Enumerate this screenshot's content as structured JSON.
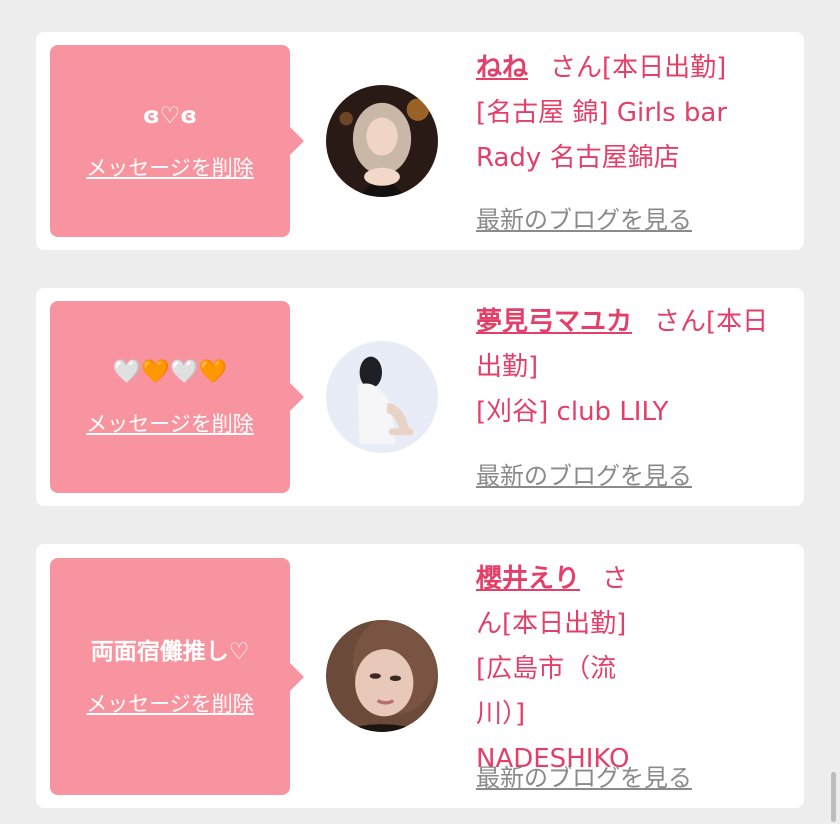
{
  "cards": [
    {
      "message": "ɞ♡ɞ",
      "delete_label": "メッセージを削除",
      "name": "ねね",
      "status": "さん[本日出勤]",
      "shop": "[名古屋 錦] Girls bar Rady 名古屋錦店",
      "blog_label": "最新のブログを見る"
    },
    {
      "message": "🤍🧡🤍🧡",
      "delete_label": "メッセージを削除",
      "name": "夢見弓マユカ",
      "status": "さん[本日出勤]",
      "shop": "[刈谷] club LILY",
      "blog_label": "最新のブログを見る"
    },
    {
      "message": "両面宿儺推し♡",
      "delete_label": "メッセージを削除",
      "name": "櫻井えり",
      "status": "さん[本日出勤]",
      "shop": "[広島市（流川）] NADESHIKO",
      "blog_label": "最新のブログを見る"
    }
  ],
  "colors": {
    "bubble": "#f8949f",
    "accent": "#e43f69",
    "background": "#ededed",
    "link_gray": "#8a8a8a"
  }
}
